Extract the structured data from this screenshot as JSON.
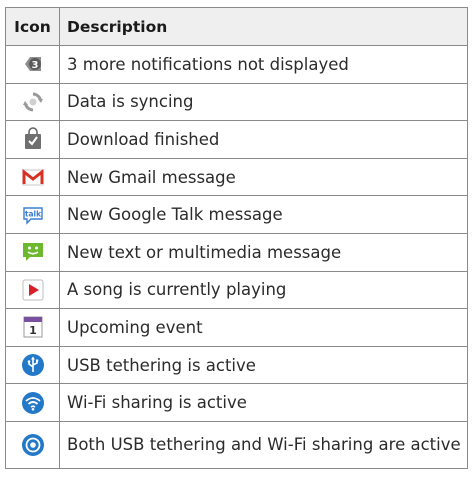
{
  "table": {
    "headers": {
      "icon": "Icon",
      "description": "Description"
    },
    "rows": [
      {
        "icon": "more-notifications-icon",
        "icon_text": "3",
        "description": "3 more notifications not displayed"
      },
      {
        "icon": "sync-icon",
        "description": "Data is syncing"
      },
      {
        "icon": "download-finished-icon",
        "description": "Download finished"
      },
      {
        "icon": "gmail-icon",
        "description": "New Gmail message"
      },
      {
        "icon": "google-talk-icon",
        "icon_text": "talk",
        "description": "New Google Talk message"
      },
      {
        "icon": "text-message-icon",
        "description": "New text or multimedia message"
      },
      {
        "icon": "song-playing-icon",
        "description": "A song is currently playing"
      },
      {
        "icon": "calendar-event-icon",
        "icon_text": "1",
        "description": "Upcoming event"
      },
      {
        "icon": "usb-tethering-icon",
        "description": "USB tethering is active"
      },
      {
        "icon": "wifi-sharing-icon",
        "description": "Wi-Fi sharing is active"
      },
      {
        "icon": "usb-wifi-sharing-icon",
        "description": "Both USB tethering and Wi-Fi sharing are active"
      }
    ]
  },
  "colors": {
    "border": "#8a8a8a",
    "header_bg": "#efefef",
    "gmail_red": "#d93025",
    "sms_green": "#6cb82e",
    "play_red": "#d9202a",
    "tether_blue": "#2478c8",
    "talk_blue": "#3a7fd0"
  }
}
